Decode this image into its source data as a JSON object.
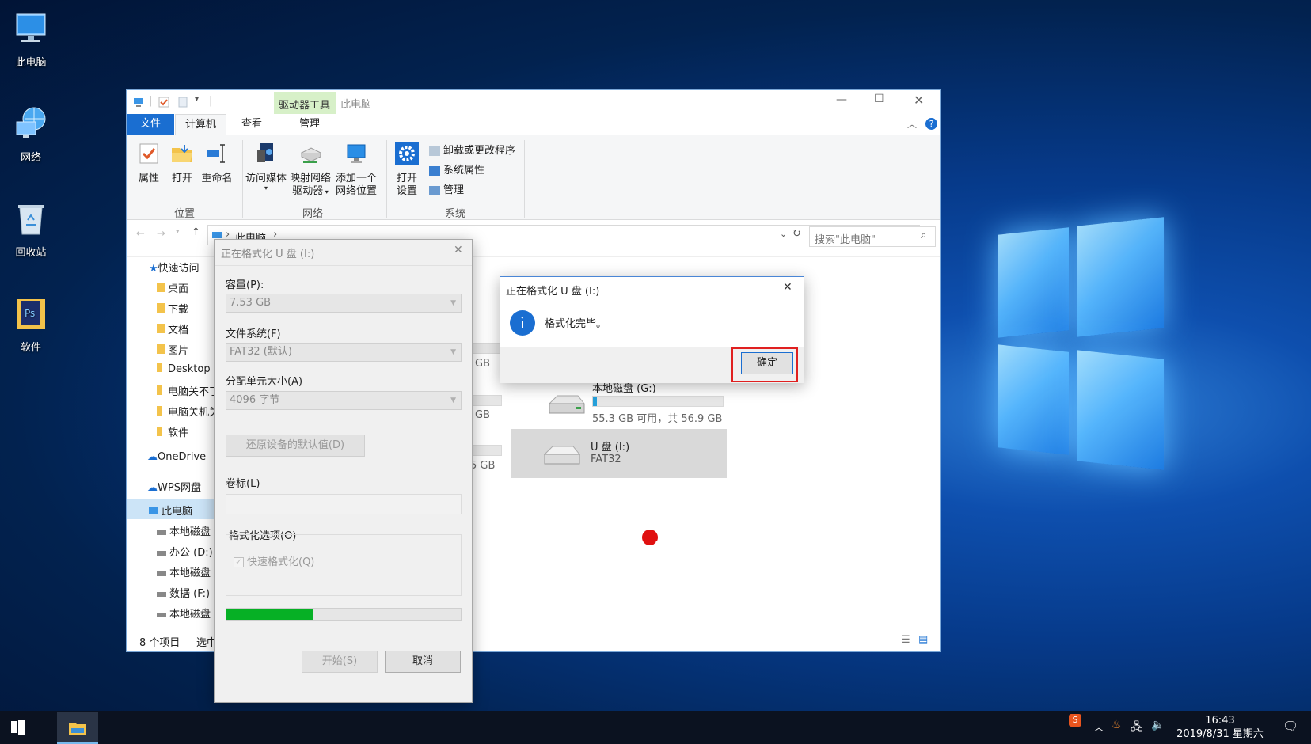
{
  "desktop": {
    "icons": [
      {
        "label": "此电脑"
      },
      {
        "label": "网络"
      },
      {
        "label": "回收站"
      },
      {
        "label": "软件"
      }
    ]
  },
  "explorer": {
    "ribbon_context_tab": "驱动器工具",
    "title": "此电脑",
    "tabs": [
      "文件",
      "计算机",
      "查看",
      "管理"
    ],
    "ribbon": {
      "buttons": {
        "properties": "属性",
        "open": "打开",
        "rename": "重命名",
        "access_media": "访问媒体",
        "map_drive_l1": "映射网络",
        "map_drive_l2": "驱动器",
        "add_location_l1": "添加一个",
        "add_location_l2": "网络位置",
        "open_settings_l1": "打开",
        "open_settings_l2": "设置",
        "uninstall": "卸载或更改程序",
        "system_props": "系统属性",
        "manage": "管理"
      },
      "groups": {
        "location": "位置",
        "network": "网络",
        "system": "系统"
      }
    },
    "address": {
      "crumb": "此电脑",
      "search_placeholder": "搜索\"此电脑\""
    },
    "nav": {
      "quick_access": "快速访问",
      "items": [
        "桌面",
        "下载",
        "文档",
        "图片",
        "Desktop",
        "电脑关不了",
        "电脑关机关",
        "软件"
      ],
      "onedrive": "OneDrive",
      "wps": "WPS网盘",
      "this_pc": "此电脑",
      "drives": [
        "本地磁盘",
        "办公 (D:)",
        "本地磁盘",
        "数据 (F:)",
        "本地磁盘"
      ]
    },
    "drives": [
      {
        "label": "本地磁盘 (G:)",
        "detail": "55.3 GB 可用，共 56.9 GB",
        "used_fraction": 0.03
      },
      {
        "label": "U 盘 (I:)",
        "detail": "FAT32"
      }
    ],
    "partial_sizes": [
      "GB",
      "GB",
      "5 GB"
    ],
    "status": {
      "count": "8 个项目",
      "selected": "选中"
    }
  },
  "format_dialog": {
    "title": "正在格式化 U 盘 (I:)",
    "capacity_label": "容量(P):",
    "capacity_value": "7.53 GB",
    "fs_label": "文件系统(F)",
    "fs_value": "FAT32 (默认)",
    "alloc_label": "分配单元大小(A)",
    "alloc_value": "4096 字节",
    "restore_button": "还原设备的默认值(D)",
    "volume_label": "卷标(L)",
    "volume_value": "",
    "options_label": "格式化选项(O)",
    "quick_format": "快速格式化(Q)",
    "progress": 0.37,
    "start_button": "开始(S)",
    "cancel_button": "取消"
  },
  "message_box": {
    "title": "正在格式化 U 盘 (I:)",
    "text": "格式化完毕。",
    "ok_button": "确定"
  },
  "taskbar": {
    "time": "16:43",
    "date": "2019/8/31 星期六"
  }
}
